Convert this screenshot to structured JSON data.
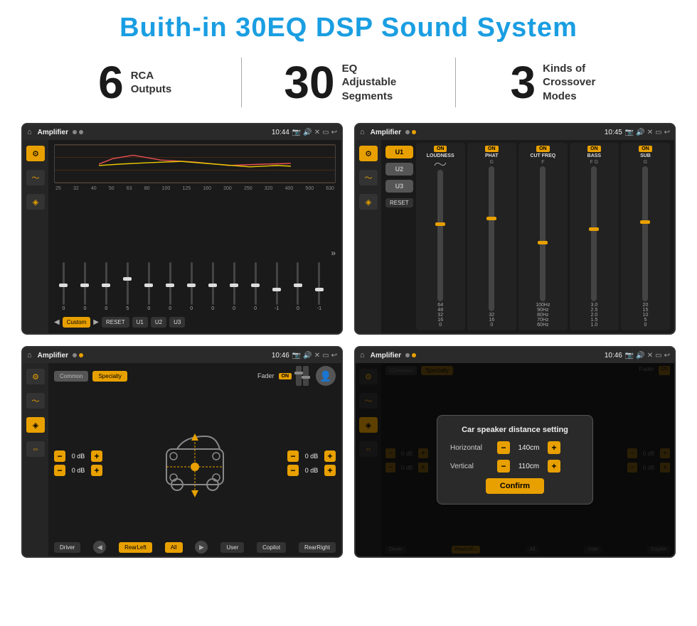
{
  "page": {
    "title": "Buith-in 30EQ DSP Sound System",
    "title_color": "#1a9ee2"
  },
  "stats": [
    {
      "number": "6",
      "label": "RCA\nOutputs"
    },
    {
      "number": "30",
      "label": "EQ Adjustable\nSegments"
    },
    {
      "number": "3",
      "label": "Kinds of\nCrossover Modes"
    }
  ],
  "screens": [
    {
      "id": "eq-screen",
      "status_bar": {
        "app_name": "Amplifier",
        "time": "10:44"
      }
    },
    {
      "id": "u-screen",
      "status_bar": {
        "app_name": "Amplifier",
        "time": "10:45"
      }
    },
    {
      "id": "cs-screen",
      "status_bar": {
        "app_name": "Amplifier",
        "time": "10:46"
      }
    },
    {
      "id": "dialog-screen",
      "status_bar": {
        "app_name": "Amplifier",
        "time": "10:46"
      },
      "dialog": {
        "title": "Car speaker distance setting",
        "horizontal_label": "Horizontal",
        "horizontal_value": "140cm",
        "vertical_label": "Vertical",
        "vertical_value": "110cm",
        "confirm_label": "Confirm"
      }
    }
  ],
  "eq": {
    "freq_labels": [
      "25",
      "32",
      "40",
      "50",
      "63",
      "80",
      "100",
      "125",
      "160",
      "200",
      "250",
      "320",
      "400",
      "500",
      "630"
    ],
    "values": [
      "0",
      "0",
      "0",
      "5",
      "0",
      "0",
      "0",
      "0",
      "0",
      "0",
      "-1",
      "0",
      "-1"
    ],
    "buttons": [
      "Custom",
      "RESET",
      "U1",
      "U2",
      "U3"
    ]
  },
  "u_screen": {
    "presets": [
      "U1",
      "U2",
      "U3"
    ],
    "controls": [
      {
        "label": "LOUDNESS",
        "on": true
      },
      {
        "label": "PHAT",
        "on": true
      },
      {
        "label": "CUT FREQ",
        "on": true
      },
      {
        "label": "BASS",
        "on": true
      },
      {
        "label": "SUB",
        "on": true
      }
    ],
    "reset_label": "RESET"
  },
  "cs_screen": {
    "tabs": [
      "Common",
      "Specialty"
    ],
    "fader_label": "Fader",
    "fader_on": "ON",
    "db_values": [
      "0 dB",
      "0 dB",
      "0 dB",
      "0 dB"
    ],
    "bottom_buttons": [
      "Driver",
      "RearLeft",
      "All",
      "Copilot",
      "RearRight",
      "User"
    ]
  }
}
